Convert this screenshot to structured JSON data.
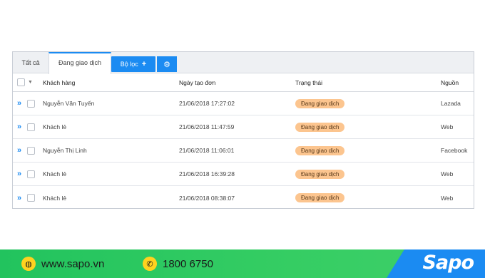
{
  "tabs": {
    "all": "Tất cả",
    "active": "Đang giao dịch"
  },
  "toolbar": {
    "filter_label": "Bộ lọc",
    "filter_icon": "plus-icon",
    "settings_icon": "gear-icon"
  },
  "table": {
    "columns": {
      "customer": "Khách hàng",
      "created": "Ngày tạo đơn",
      "status": "Trạng thái",
      "source": "Nguồn"
    },
    "rows": [
      {
        "customer": "Nguyễn Văn Tuyến",
        "created": "21/06/2018 17:27:02",
        "status": "Đang giao dịch",
        "source": "Lazada"
      },
      {
        "customer": "Khách lẻ",
        "created": "21/06/2018 11:47:59",
        "status": "Đang giao dịch",
        "source": "Web"
      },
      {
        "customer": "Nguyễn Thị Linh",
        "created": "21/06/2018 11:06:01",
        "status": "Đang giao dịch",
        "source": "Facebook"
      },
      {
        "customer": "Khách lẻ",
        "created": "21/06/2018  16:39:28",
        "status": "Đang giao dịch",
        "source": "Web"
      },
      {
        "customer": "Khách lẻ",
        "created": "21/06/2018 08:38:07",
        "status": "Đang giao dịch",
        "source": "Web"
      }
    ]
  },
  "footer": {
    "website": "www.sapo.vn",
    "phone": "1800 6750",
    "brand": "Sapo"
  },
  "colors": {
    "accent": "#1b8bf2",
    "status_badge": "#fcc58f",
    "footer_green": "#2ec760",
    "icon_yellow": "#ffd21f"
  }
}
